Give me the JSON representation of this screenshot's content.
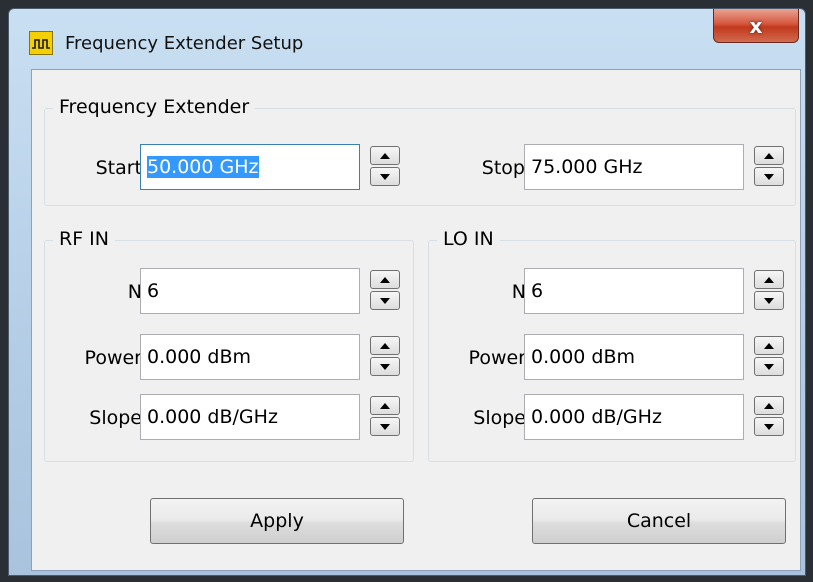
{
  "window": {
    "title": "Frequency Extender Setup",
    "close_label": "x"
  },
  "frequency_extender": {
    "label": "Frequency Extender",
    "start_label": "Start",
    "start_value": "50.000 GHz",
    "stop_label": "Stop",
    "stop_value": "75.000 GHz"
  },
  "rf_in": {
    "label": "RF IN",
    "n_label": "N",
    "n_value": "6",
    "power_label": "Power",
    "power_value": "0.000 dBm",
    "slope_label": "Slope",
    "slope_value": "0.000 dB/GHz"
  },
  "lo_in": {
    "label": "LO IN",
    "n_label": "N",
    "n_value": "6",
    "power_label": "Power",
    "power_value": "0.000 dBm",
    "slope_label": "Slope",
    "slope_value": "0.000 dB/GHz"
  },
  "buttons": {
    "apply": "Apply",
    "cancel": "Cancel"
  },
  "icons": {
    "app": "waveform-icon",
    "close": "close-icon",
    "spin_up": "spin-up-icon",
    "spin_down": "spin-down-icon"
  },
  "colors": {
    "selection": "#3399ff",
    "close_button": "#c2391d",
    "dialog_background": "#f0f0f0"
  }
}
